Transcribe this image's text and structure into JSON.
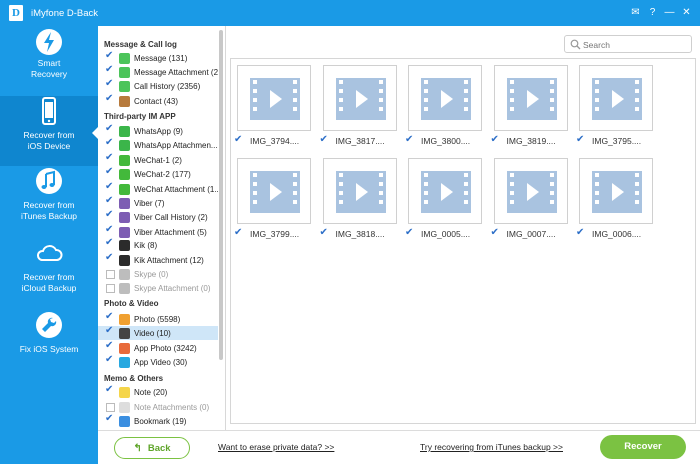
{
  "app": {
    "title": "iMyfone D-Back",
    "logo_letter": "D"
  },
  "window_controls": [
    "✉",
    "?",
    "—",
    "✕"
  ],
  "nav": [
    {
      "label1": "Smart",
      "label2": "Recovery",
      "icon": "lightning-icon"
    },
    {
      "label1": "Recover from",
      "label2": "iOS Device",
      "icon": "iphone-icon"
    },
    {
      "label1": "Recover from",
      "label2": "iTunes Backup",
      "icon": "music-note-icon"
    },
    {
      "label1": "Recover from",
      "label2": "iCloud Backup",
      "icon": "cloud-icon"
    },
    {
      "label1": "Fix iOS System",
      "label2": "",
      "icon": "wrench-icon"
    }
  ],
  "categories": {
    "headers": [
      "Message & Call log",
      "Third-party IM APP",
      "Photo & Video",
      "Memo & Others"
    ],
    "items": [
      {
        "label": "Message (131)",
        "checked": true,
        "color": "#4cc45a"
      },
      {
        "label": "Message Attachment (2",
        "checked": true,
        "color": "#4cc45a"
      },
      {
        "label": "Call History (2356)",
        "checked": true,
        "color": "#4cc45a"
      },
      {
        "label": "Contact (43)",
        "checked": true,
        "color": "#b77a3c"
      },
      {
        "label": "WhatsApp (9)",
        "checked": true,
        "color": "#3bb54a"
      },
      {
        "label": "WhatsApp Attachmen...",
        "checked": true,
        "color": "#3bb54a"
      },
      {
        "label": "WeChat-1 (2)",
        "checked": true,
        "color": "#43b93b"
      },
      {
        "label": "WeChat-2 (177)",
        "checked": true,
        "color": "#43b93b"
      },
      {
        "label": "WeChat Attachment (1...",
        "checked": true,
        "color": "#43b93b"
      },
      {
        "label": "Viber (7)",
        "checked": true,
        "color": "#7d5db3"
      },
      {
        "label": "Viber Call History (2)",
        "checked": true,
        "color": "#7d5db3"
      },
      {
        "label": "Viber Attachment (5)",
        "checked": true,
        "color": "#7d5db3"
      },
      {
        "label": "Kik (8)",
        "checked": true,
        "color": "#2b2b2b"
      },
      {
        "label": "Kik Attachment (12)",
        "checked": true,
        "color": "#2b2b2b"
      },
      {
        "label": "Skype (0)",
        "checked": false,
        "color": "#bdbdbd"
      },
      {
        "label": "Skype Attachment (0)",
        "checked": false,
        "color": "#bdbdbd"
      },
      {
        "label": "Photo (5598)",
        "checked": true,
        "color": "#f0a030"
      },
      {
        "label": "Video (10)",
        "checked": true,
        "color": "#444"
      },
      {
        "label": "App Photo (3242)",
        "checked": true,
        "color": "#e86a3a"
      },
      {
        "label": "App Video (30)",
        "checked": true,
        "color": "#27a8e0"
      },
      {
        "label": "Note (20)",
        "checked": true,
        "color": "#f5d54a"
      },
      {
        "label": "Note Attachments (0)",
        "checked": false,
        "color": "#dddddd"
      },
      {
        "label": "Bookmark (19)",
        "checked": true,
        "color": "#3a8ee0"
      }
    ]
  },
  "search": {
    "placeholder": "Search"
  },
  "videos": [
    "IMG_3794....",
    "IMG_3817....",
    "IMG_3800....",
    "IMG_3819....",
    "IMG_3795....",
    "IMG_3799....",
    "IMG_3818....",
    "IMG_0005....",
    "IMG_0007....",
    "IMG_0006...."
  ],
  "footer": {
    "back_label": "Back",
    "erase_link": "Want to erase private data? >>",
    "itunes_link": "Try recovering from iTunes backup >>",
    "recover_label": "Recover"
  },
  "colors": {
    "brand": "#1a9ae6",
    "accent_green": "#7bc242"
  }
}
